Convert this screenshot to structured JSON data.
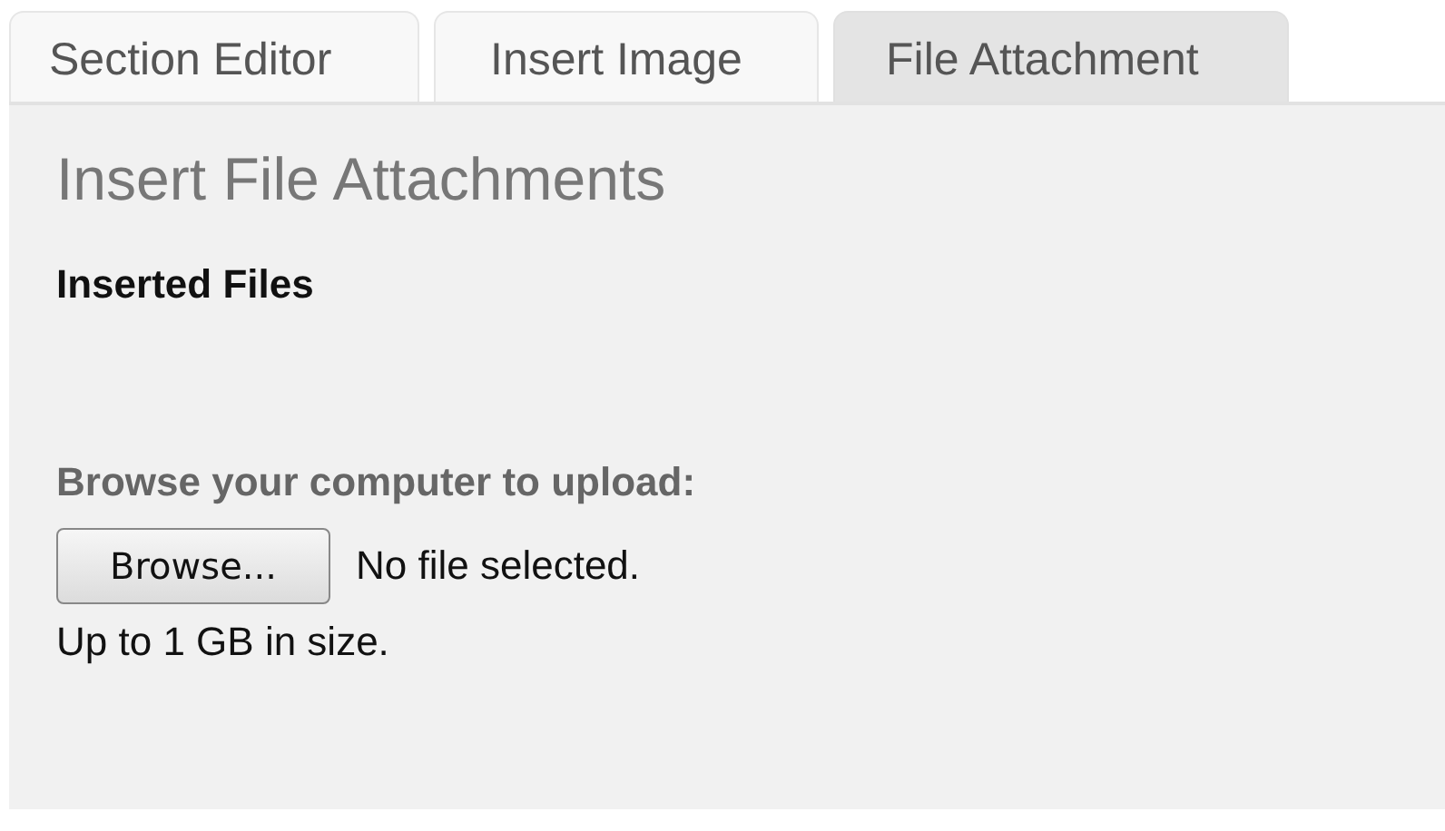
{
  "tabs": [
    {
      "label": "Section Editor",
      "selected": false
    },
    {
      "label": "Insert Image",
      "selected": false
    },
    {
      "label": "File Attachment",
      "selected": true
    }
  ],
  "panel": {
    "title": "Insert File Attachments",
    "inserted_files_label": "Inserted Files",
    "upload_label": "Browse your computer to upload:",
    "browse_button": "Browse...",
    "file_status": "No file selected.",
    "size_note": "Up to 1 GB in size."
  }
}
